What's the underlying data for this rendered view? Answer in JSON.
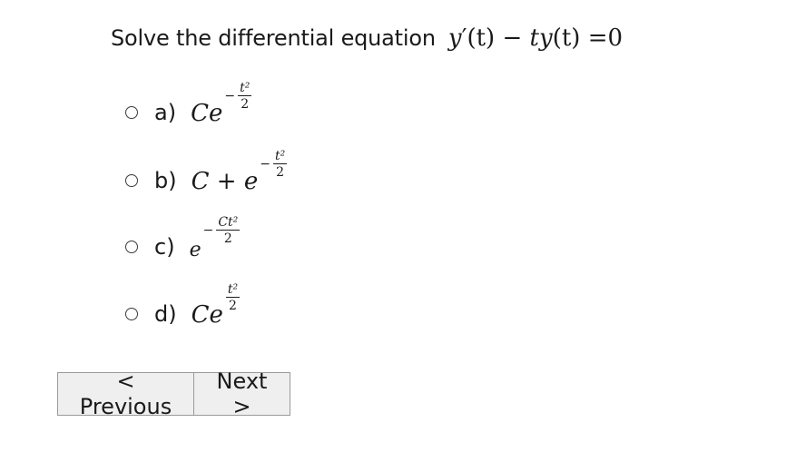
{
  "question": {
    "prompt": "Solve the differential equation",
    "equation": {
      "lhs_fn": "y",
      "prime": "′",
      "arg": "(t)",
      "minus": " − ",
      "term": "ty",
      "term_arg": "(t)",
      "equals": " =",
      "rhs": "0"
    }
  },
  "options": [
    {
      "label": "a)",
      "base": "Ce",
      "exp_sign": "−",
      "exp_num": "t²",
      "exp_den": "2"
    },
    {
      "label": "b)",
      "prefix": "C + ",
      "base": "e",
      "exp_sign": "−",
      "exp_num": "t²",
      "exp_den": "2"
    },
    {
      "label": "c)",
      "base": "e",
      "exp_sign": "−",
      "exp_num": "Ct²",
      "exp_den": "2"
    },
    {
      "label": "d)",
      "base": "Ce",
      "exp_sign": "",
      "exp_num": "t²",
      "exp_den": "2"
    }
  ],
  "nav": {
    "previous_label": "< Previous",
    "next_label": "Next >"
  }
}
